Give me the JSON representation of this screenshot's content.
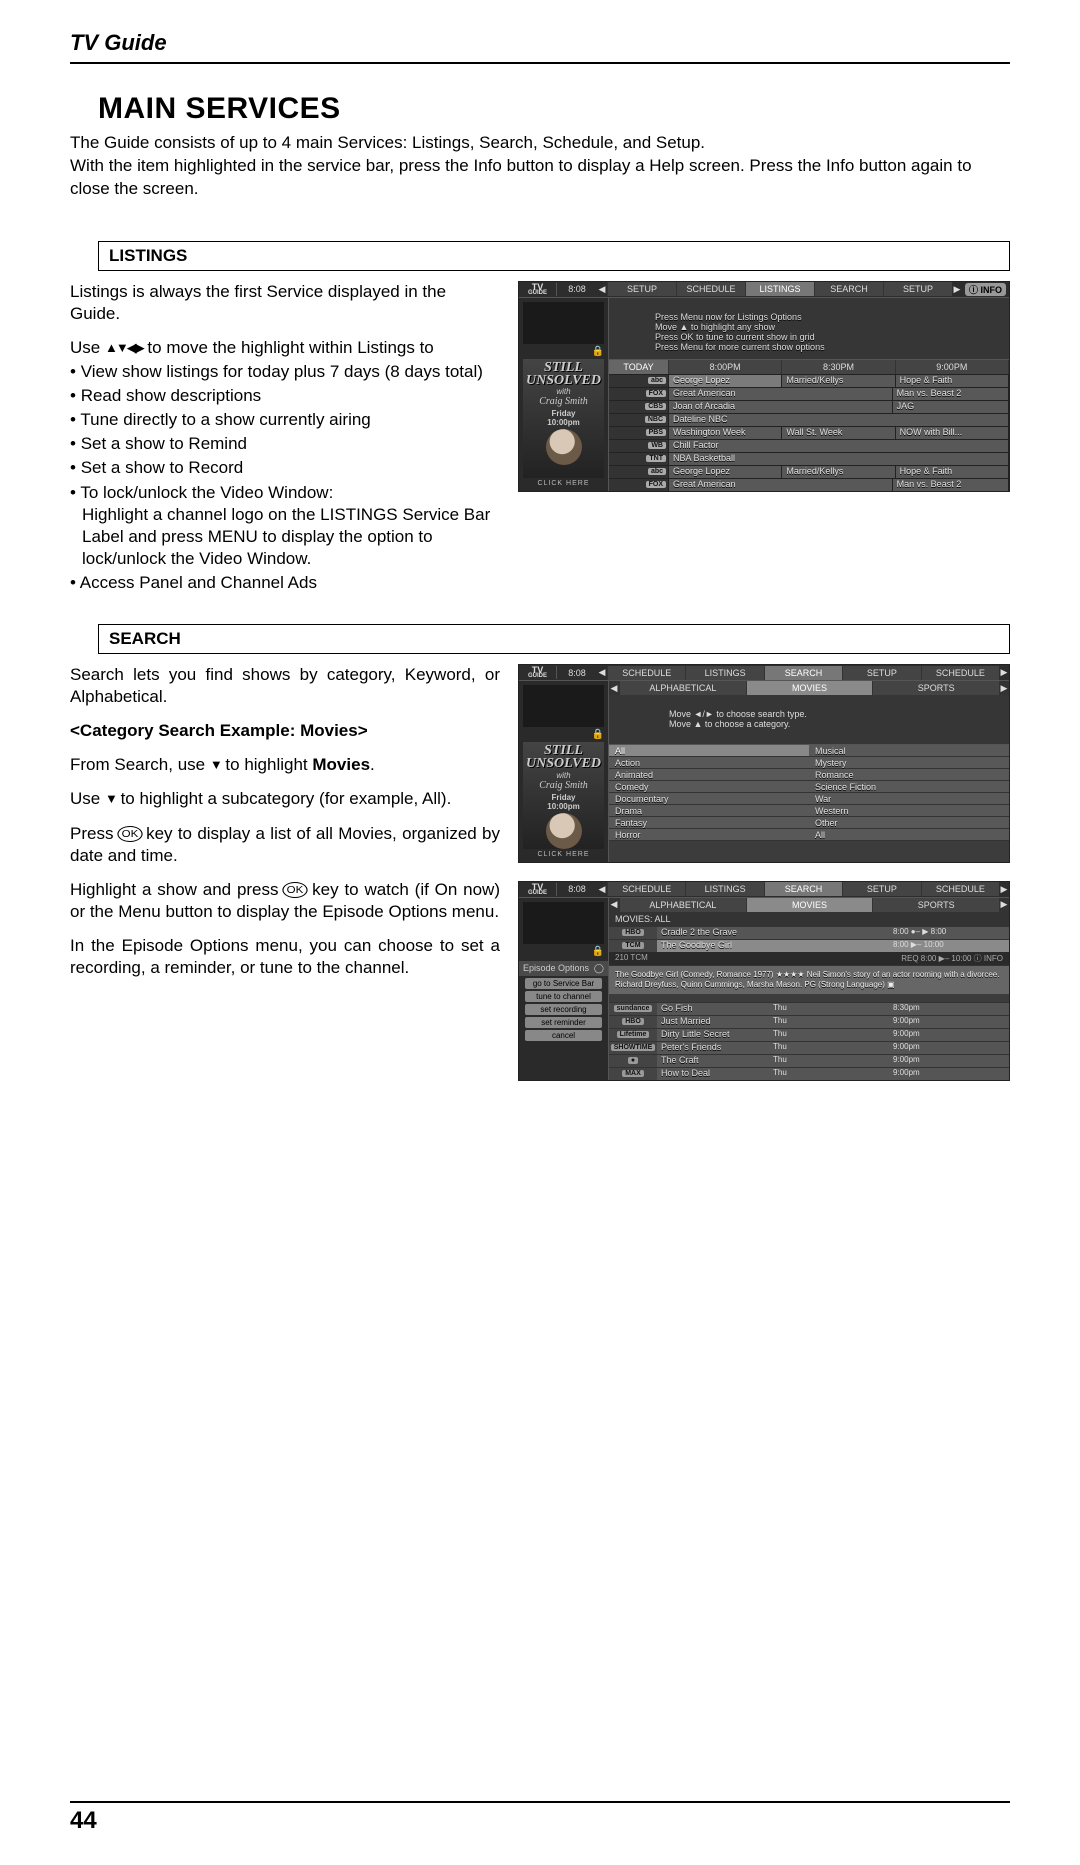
{
  "header": {
    "title": "TV Guide"
  },
  "main_title": "MAIN SERVICES",
  "intro_lines": [
    "The Guide consists of up to 4 main Services: Listings, Search, Schedule, and Setup.",
    "With the item highlighted in the service bar, press the Info button to display a Help screen. Press the Info button again to close the screen."
  ],
  "page_number": "44",
  "listings": {
    "heading": "LISTINGS",
    "intro": "Listings is always the first Service displayed in the Guide.",
    "use_line_prefix": "Use ",
    "use_line_suffix": " to move the highlight within Listings to",
    "bullets": [
      "View show listings for today plus 7 days (8 days total)",
      "Read show descriptions",
      "Tune directly to a show currently airing",
      "Set a show to Remind",
      "Set a show to Record"
    ],
    "bullet_lock_head": "To lock/unlock the Video Window:",
    "bullet_lock_body": "Highlight a channel logo on the LISTINGS Service Bar Label and press MENU to display the option to lock/unlock the Video Window.",
    "bullet_last": "Access Panel and Channel Ads"
  },
  "search": {
    "heading": "SEARCH",
    "intro": "Search lets you find shows by category, Keyword, or Alphabetical.",
    "subhead": "<Category Search Example: Movies>",
    "line1_prefix": "From Search, use ",
    "line1_suffix": " to highlight ",
    "line1_bold": "Movies",
    "line1_end": ".",
    "line2_prefix": "Use ",
    "line2_suffix": " to highlight a subcategory (for example, All).",
    "line3_prefix": "Press ",
    "line3_suffix": " key  to display a list of all Movies, organized by date and time.",
    "line4_prefix": "Highlight a show and press ",
    "line4_suffix": " key to watch (if On now) or the Menu button to display the Episode Options menu.",
    "line5": "In the Episode Options menu, you can choose to set a recording, a reminder, or tune to the channel."
  },
  "shot_common": {
    "logo_top": "TV",
    "logo_bottom": "GUIDE",
    "time": "8:08",
    "info_label": "INFO",
    "click_here": "CLICK HERE",
    "promo_word1": "STILL",
    "promo_word2": "UNSOLVED",
    "promo_with": "with",
    "promo_name": "Craig Smith",
    "promo_date1": "Friday",
    "promo_date2": "10:00pm"
  },
  "shot1": {
    "tabs": [
      "SETUP",
      "SCHEDULE",
      "LISTINGS",
      "SEARCH",
      "SETUP"
    ],
    "active_tab": 2,
    "help": [
      "Press Menu now for Listings Options",
      "Move ▲ to highlight any show",
      "Press OK to tune to current show in grid",
      "Press Menu for more current show options"
    ],
    "today": "TODAY",
    "time_cols": [
      "8:00PM",
      "8:30PM",
      "9:00PM"
    ],
    "rows": [
      {
        "ch": "",
        "logo": "abc",
        "cells": [
          {
            "t": "George Lopez",
            "w": 1,
            "hi": true
          },
          {
            "t": "Married/Kellys",
            "w": 1
          },
          {
            "t": "Hope & Faith",
            "w": 1
          }
        ]
      },
      {
        "ch": "",
        "logo": "FOX",
        "cells": [
          {
            "t": "Great American",
            "w": 2
          },
          {
            "t": "Man vs. Beast 2",
            "w": 1
          }
        ]
      },
      {
        "ch": "",
        "logo": "CBS",
        "cells": [
          {
            "t": "Joan of Arcadia",
            "w": 2
          },
          {
            "t": "JAG",
            "w": 1
          }
        ]
      },
      {
        "ch": "",
        "logo": "NBC",
        "cells": [
          {
            "t": "Dateline NBC",
            "w": 3
          }
        ]
      },
      {
        "ch": "",
        "logo": "PBS",
        "cells": [
          {
            "t": "Washington Week",
            "w": 1
          },
          {
            "t": "Wall St. Week",
            "w": 1
          },
          {
            "t": "NOW with Bill...",
            "w": 1
          }
        ]
      },
      {
        "ch": "",
        "logo": "WB",
        "cells": [
          {
            "t": "Chill Factor",
            "w": 3
          }
        ]
      },
      {
        "ch": "",
        "logo": "TNT",
        "cells": [
          {
            "t": "NBA Basketball",
            "w": 3
          }
        ]
      },
      {
        "ch": "",
        "logo": "abc",
        "cells": [
          {
            "t": "George Lopez",
            "w": 1
          },
          {
            "t": "Married/Kellys",
            "w": 1
          },
          {
            "t": "Hope & Faith",
            "w": 1
          }
        ]
      },
      {
        "ch": "",
        "logo": "FOX",
        "cells": [
          {
            "t": "Great American",
            "w": 2
          },
          {
            "t": "Man vs. Beast 2",
            "w": 1
          }
        ]
      }
    ]
  },
  "shot2": {
    "tabs": [
      "SCHEDULE",
      "LISTINGS",
      "SEARCH",
      "SETUP",
      "SCHEDULE"
    ],
    "active_tab": 2,
    "subtabs": [
      "ALPHABETICAL",
      "MOVIES",
      "SPORTS"
    ],
    "active_subtab": 1,
    "help": [
      "Move ◄/► to choose search type.",
      "Move ▲ to choose a category."
    ],
    "left_col": [
      "All",
      "Action",
      "Animated",
      "Comedy",
      "Documentary",
      "Drama",
      "Fantasy",
      "Horror"
    ],
    "right_col": [
      "Musical",
      "Mystery",
      "Romance",
      "Science Fiction",
      "War",
      "Western",
      "Other",
      "All"
    ],
    "highlight_index": 0
  },
  "shot3": {
    "tabs": [
      "SCHEDULE",
      "LISTINGS",
      "SEARCH",
      "SETUP",
      "SCHEDULE"
    ],
    "active_tab": 2,
    "subtabs": [
      "ALPHABETICAL",
      "MOVIES",
      "SPORTS"
    ],
    "active_subtab": 1,
    "crumb": "MOVIES: ALL",
    "sidebar_title": "Episode Options",
    "sidebar_items": [
      "go to Service Bar",
      "tune to channel",
      "set recording",
      "set reminder",
      "cancel"
    ],
    "top_rows": [
      {
        "logo": "HBO",
        "title": "Cradle 2 the Grave",
        "meta": "8:00 ●– ▶ 8:00"
      },
      {
        "logo": "TCM",
        "title": "The Goodbye Girl",
        "meta": "8:00 ▶– 10:00",
        "hi": true
      }
    ],
    "tinyline": "210 TCM",
    "tinyline_right": "REQ  8:00 ▶– 10:00  ⓘ INFO",
    "description": "The Goodbye Girl (Comedy, Romance 1977) ★★★★ Neil Simon's story of an actor rooming with a divorcee. Richard Dreyfuss, Quinn Cummings, Marsha Mason. PG (Strong Language) ▣",
    "bottom_rows": [
      {
        "logo": "sundance",
        "title": "Go Fish",
        "day": "Thu",
        "time": "8:30pm"
      },
      {
        "logo": "HBO",
        "title": "Just Married",
        "day": "Thu",
        "time": "9:00pm"
      },
      {
        "logo": "Lifetime",
        "title": "Dirty Little Secret",
        "day": "Thu",
        "time": "9:00pm"
      },
      {
        "logo": "SHOWTIME",
        "title": "Peter's Friends",
        "day": "Thu",
        "time": "9:00pm"
      },
      {
        "logo": "●",
        "title": "The Craft",
        "day": "Thu",
        "time": "9:00pm"
      },
      {
        "logo": "MAX",
        "title": "How to Deal",
        "day": "Thu",
        "time": "9:00pm"
      }
    ]
  }
}
